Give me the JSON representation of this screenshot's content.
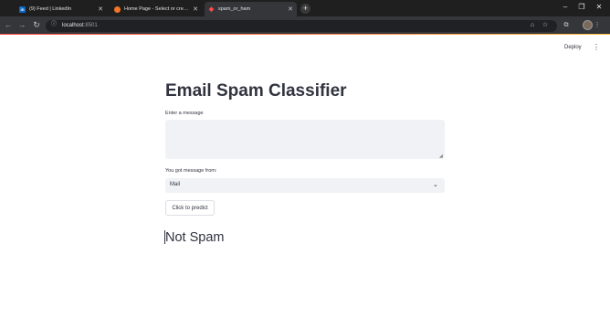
{
  "browser": {
    "tabs": [
      {
        "label": "(9) Feed | LinkedIn",
        "favicon": "linkedin-icon",
        "favicon_color": "#0a66c2",
        "active": false
      },
      {
        "label": "Home Page - Select or create a",
        "favicon": "jupyter-icon",
        "favicon_color": "#f37626",
        "active": false
      },
      {
        "label": "spam_or_ham",
        "favicon": "streamlit-icon",
        "favicon_color": "#ff4b4b",
        "active": true
      }
    ],
    "new_tab_label": "+",
    "url_host": "localhost",
    "url_port": ":8501"
  },
  "app": {
    "deploy_label": "Deploy",
    "title": "Email Spam Classifier",
    "message_label": "Enter a message",
    "message_value": "",
    "source_label": "You got message from:",
    "source_selected": "Mail",
    "predict_button": "Click to predict",
    "result": "Not Spam"
  },
  "colors": {
    "accent": "#ff4b4b",
    "text": "#31333f",
    "input_bg": "#f0f2f6",
    "tabbar_bg": "#1f1f1f",
    "toolbar_bg": "#35363a"
  }
}
